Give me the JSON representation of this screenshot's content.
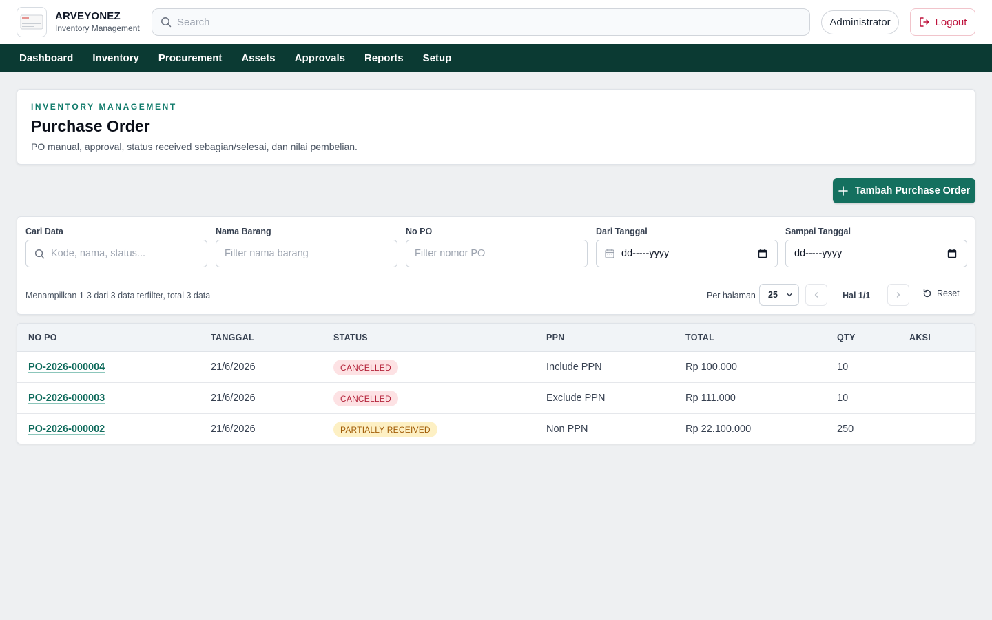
{
  "brand": {
    "name": "ARVEYONEZ",
    "subtitle": "Inventory Management"
  },
  "search": {
    "placeholder": "Search"
  },
  "user": {
    "name": "Administrator",
    "logout_label": "Logout"
  },
  "nav": [
    "Dashboard",
    "Inventory",
    "Procurement",
    "Assets",
    "Approvals",
    "Reports",
    "Setup"
  ],
  "page": {
    "eyebrow": "INVENTORY MANAGEMENT",
    "title": "Purchase Order",
    "description": "PO manual, approval, status received sebagian/selesai, dan nilai pembelian.",
    "add_button": "Tambah Purchase Order"
  },
  "filters": {
    "search": {
      "label": "Cari Data",
      "placeholder": "Kode, nama, status..."
    },
    "item_name": {
      "label": "Nama Barang",
      "placeholder": "Filter nama barang"
    },
    "po_number": {
      "label": "No PO",
      "placeholder": "Filter nomor PO"
    },
    "date_from": {
      "label": "Dari Tanggal",
      "value": "dd-----yyyy"
    },
    "date_to": {
      "label": "Sampai Tanggal",
      "value": "dd-----yyyy"
    },
    "summary": "Menampilkan 1-3 dari 3 data terfilter, total 3 data",
    "per_page_label": "Per halaman",
    "per_page_value": "25",
    "page_indicator": "Hal 1/1",
    "reset_label": "Reset"
  },
  "table": {
    "headers": [
      "NO PO",
      "TANGGAL",
      "STATUS",
      "PPN",
      "TOTAL",
      "QTY",
      "AKSI"
    ],
    "rows": [
      {
        "no_po": "PO-2026-000004",
        "tanggal": "21/6/2026",
        "status": "CANCELLED",
        "ppn": "Include PPN",
        "total": "Rp 100.000",
        "qty": "10"
      },
      {
        "no_po": "PO-2026-000003",
        "tanggal": "21/6/2026",
        "status": "CANCELLED",
        "ppn": "Exclude PPN",
        "total": "Rp 111.000",
        "qty": "10"
      },
      {
        "no_po": "PO-2026-000002",
        "tanggal": "21/6/2026",
        "status": "PARTIALLY RECEIVED",
        "ppn": "Non PPN",
        "total": "Rp 22.100.000",
        "qty": "250"
      }
    ]
  },
  "colors": {
    "nav_bg": "#0b3a33",
    "accent": "#14705f",
    "cancelled_bg": "#fde2e4",
    "cancelled_text": "#b4233a",
    "partial_bg": "#fdf0c4",
    "partial_text": "#a15c07"
  }
}
